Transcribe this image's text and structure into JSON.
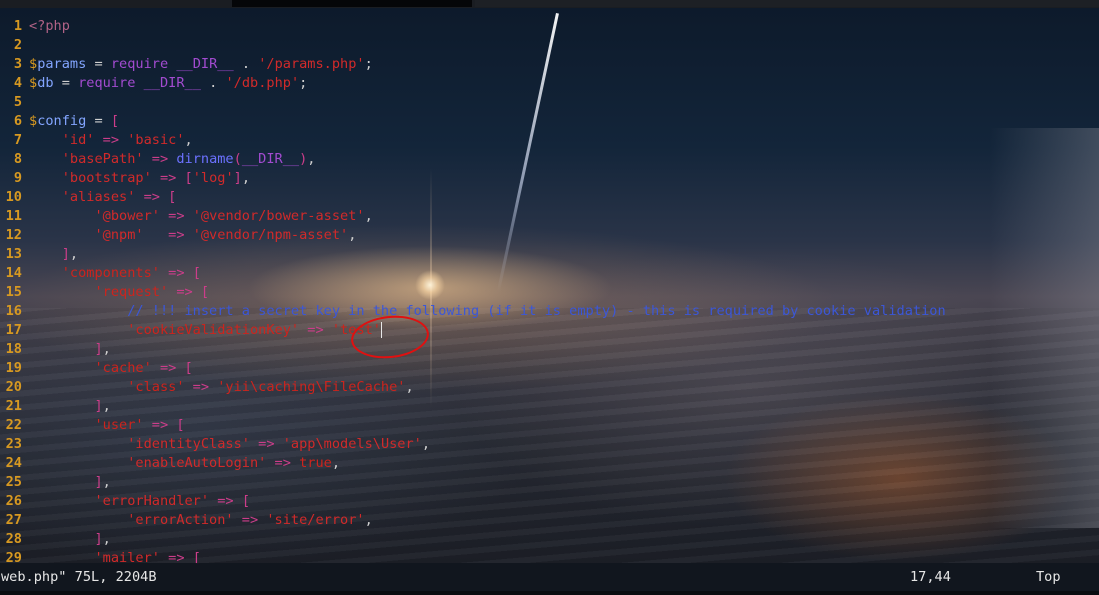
{
  "editor": {
    "lines": [
      {
        "n": "1",
        "tokens": [
          {
            "t": "<?php",
            "c": "tag"
          }
        ]
      },
      {
        "n": "2",
        "tokens": []
      },
      {
        "n": "3",
        "tokens": [
          {
            "t": "$",
            "c": "dollar"
          },
          {
            "t": "params",
            "c": "var"
          },
          {
            "t": " = ",
            "c": "punct"
          },
          {
            "t": "require",
            "c": "kw"
          },
          {
            "t": " ",
            "c": "punct"
          },
          {
            "t": "__DIR__",
            "c": "const"
          },
          {
            "t": " . ",
            "c": "punct"
          },
          {
            "t": "'/params.php'",
            "c": "str"
          },
          {
            "t": ";",
            "c": "punct"
          }
        ]
      },
      {
        "n": "4",
        "tokens": [
          {
            "t": "$",
            "c": "dollar"
          },
          {
            "t": "db",
            "c": "var"
          },
          {
            "t": " = ",
            "c": "punct"
          },
          {
            "t": "require",
            "c": "kw"
          },
          {
            "t": " ",
            "c": "punct"
          },
          {
            "t": "__DIR__",
            "c": "const"
          },
          {
            "t": " . ",
            "c": "punct"
          },
          {
            "t": "'/db.php'",
            "c": "str"
          },
          {
            "t": ";",
            "c": "punct"
          }
        ]
      },
      {
        "n": "5",
        "tokens": []
      },
      {
        "n": "6",
        "tokens": [
          {
            "t": "$",
            "c": "dollar"
          },
          {
            "t": "config",
            "c": "var"
          },
          {
            "t": " = ",
            "c": "punct"
          },
          {
            "t": "[",
            "c": "op"
          }
        ]
      },
      {
        "n": "7",
        "tokens": [
          {
            "t": "    'id'",
            "c": "str"
          },
          {
            "t": " => ",
            "c": "op"
          },
          {
            "t": "'basic'",
            "c": "str"
          },
          {
            "t": ",",
            "c": "punct"
          }
        ]
      },
      {
        "n": "8",
        "tokens": [
          {
            "t": "    'basePath'",
            "c": "str"
          },
          {
            "t": " => ",
            "c": "op"
          },
          {
            "t": "dirname",
            "c": "fn"
          },
          {
            "t": "(",
            "c": "op"
          },
          {
            "t": "__DIR__",
            "c": "const"
          },
          {
            "t": ")",
            "c": "op"
          },
          {
            "t": ",",
            "c": "punct"
          }
        ]
      },
      {
        "n": "9",
        "tokens": [
          {
            "t": "    'bootstrap'",
            "c": "str"
          },
          {
            "t": " => ",
            "c": "op"
          },
          {
            "t": "[",
            "c": "op"
          },
          {
            "t": "'log'",
            "c": "str"
          },
          {
            "t": "]",
            "c": "op"
          },
          {
            "t": ",",
            "c": "punct"
          }
        ]
      },
      {
        "n": "10",
        "tokens": [
          {
            "t": "    'aliases'",
            "c": "str"
          },
          {
            "t": " => ",
            "c": "op"
          },
          {
            "t": "[",
            "c": "op"
          }
        ]
      },
      {
        "n": "11",
        "tokens": [
          {
            "t": "        '@bower'",
            "c": "str"
          },
          {
            "t": " => ",
            "c": "op"
          },
          {
            "t": "'@vendor/bower-asset'",
            "c": "str"
          },
          {
            "t": ",",
            "c": "punct"
          }
        ]
      },
      {
        "n": "12",
        "tokens": [
          {
            "t": "        '@npm'",
            "c": "str"
          },
          {
            "t": "   => ",
            "c": "op"
          },
          {
            "t": "'@vendor/npm-asset'",
            "c": "str"
          },
          {
            "t": ",",
            "c": "punct"
          }
        ]
      },
      {
        "n": "13",
        "tokens": [
          {
            "t": "    ]",
            "c": "op"
          },
          {
            "t": ",",
            "c": "punct"
          }
        ]
      },
      {
        "n": "14",
        "tokens": [
          {
            "t": "    'components'",
            "c": "str2"
          },
          {
            "t": " => ",
            "c": "op"
          },
          {
            "t": "[",
            "c": "op"
          }
        ]
      },
      {
        "n": "15",
        "tokens": [
          {
            "t": "        'request'",
            "c": "str2"
          },
          {
            "t": " => ",
            "c": "op"
          },
          {
            "t": "[",
            "c": "op"
          }
        ]
      },
      {
        "n": "16",
        "tokens": [
          {
            "t": "            // !!! insert a secret key in the following (if it is empty) - this is required by cookie validation",
            "c": "comment"
          }
        ]
      },
      {
        "n": "17",
        "tokens": [
          {
            "t": "            'cookieValidationKey'",
            "c": "str2"
          },
          {
            "t": " => ",
            "c": "op"
          },
          {
            "t": "'test'",
            "c": "str2"
          }
        ],
        "cursor": true
      },
      {
        "n": "18",
        "tokens": [
          {
            "t": "        ]",
            "c": "op"
          },
          {
            "t": ",",
            "c": "punct"
          }
        ]
      },
      {
        "n": "19",
        "tokens": [
          {
            "t": "        'cache'",
            "c": "str2"
          },
          {
            "t": " => ",
            "c": "op"
          },
          {
            "t": "[",
            "c": "op"
          }
        ]
      },
      {
        "n": "20",
        "tokens": [
          {
            "t": "            'class'",
            "c": "str2"
          },
          {
            "t": " => ",
            "c": "op"
          },
          {
            "t": "'yii\\caching\\FileCache'",
            "c": "str2"
          },
          {
            "t": ",",
            "c": "punct"
          }
        ]
      },
      {
        "n": "21",
        "tokens": [
          {
            "t": "        ]",
            "c": "op"
          },
          {
            "t": ",",
            "c": "punct"
          }
        ]
      },
      {
        "n": "22",
        "tokens": [
          {
            "t": "        'user'",
            "c": "str2"
          },
          {
            "t": " => ",
            "c": "op"
          },
          {
            "t": "[",
            "c": "op"
          }
        ]
      },
      {
        "n": "23",
        "tokens": [
          {
            "t": "            'identityClass'",
            "c": "str"
          },
          {
            "t": " => ",
            "c": "op"
          },
          {
            "t": "'app\\models\\User'",
            "c": "str"
          },
          {
            "t": ",",
            "c": "punct"
          }
        ]
      },
      {
        "n": "24",
        "tokens": [
          {
            "t": "            'enableAutoLogin'",
            "c": "str"
          },
          {
            "t": " => ",
            "c": "op"
          },
          {
            "t": "true",
            "c": "bool"
          },
          {
            "t": ",",
            "c": "punct"
          }
        ]
      },
      {
        "n": "25",
        "tokens": [
          {
            "t": "        ]",
            "c": "op"
          },
          {
            "t": ",",
            "c": "punct"
          }
        ]
      },
      {
        "n": "26",
        "tokens": [
          {
            "t": "        'errorHandler'",
            "c": "str"
          },
          {
            "t": " => ",
            "c": "op"
          },
          {
            "t": "[",
            "c": "op"
          }
        ]
      },
      {
        "n": "27",
        "tokens": [
          {
            "t": "            'errorAction'",
            "c": "str"
          },
          {
            "t": " => ",
            "c": "op"
          },
          {
            "t": "'site/error'",
            "c": "str"
          },
          {
            "t": ",",
            "c": "punct"
          }
        ]
      },
      {
        "n": "28",
        "tokens": [
          {
            "t": "        ]",
            "c": "op"
          },
          {
            "t": ",",
            "c": "punct"
          }
        ]
      },
      {
        "n": "29",
        "tokens": [
          {
            "t": "        'mailer'",
            "c": "str"
          },
          {
            "t": " => ",
            "c": "op"
          },
          {
            "t": "[",
            "c": "op"
          }
        ]
      }
    ]
  },
  "statusline": {
    "file_info": "web.php\" 75L, 2204B",
    "cursor_position": "17,44",
    "scroll_position": "Top"
  },
  "colors": {
    "line_number": "#d79921",
    "string": "#d12a2a",
    "operator": "#cc3d8a",
    "variable": "#83a5ff",
    "comment": "#3b57d8",
    "annotation": "#e01010"
  }
}
